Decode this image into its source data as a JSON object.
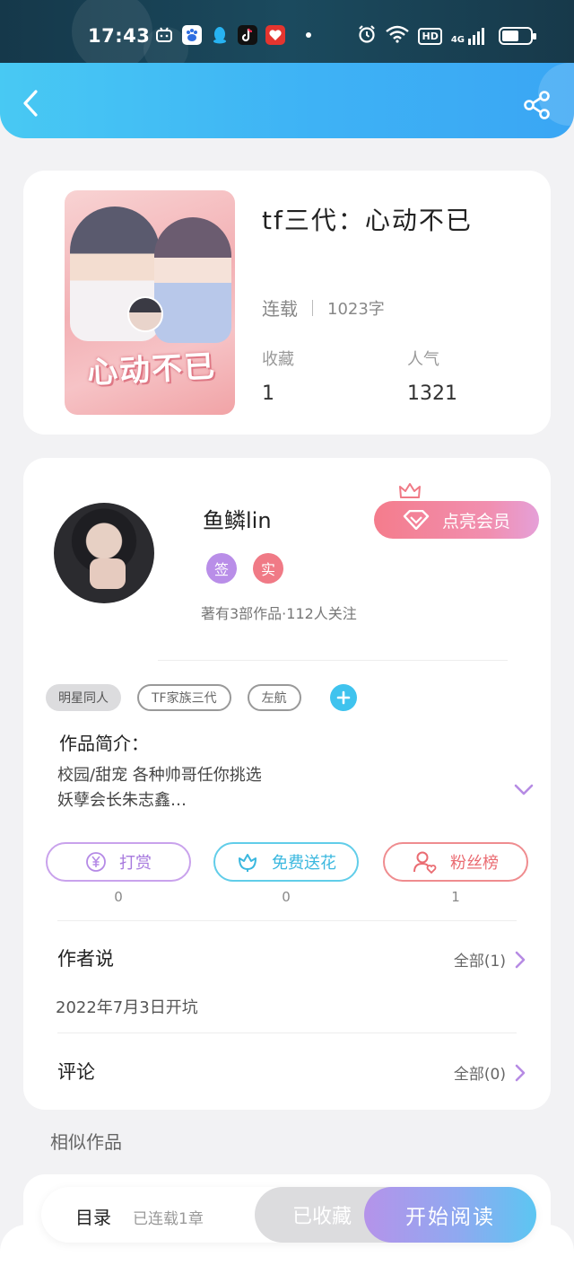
{
  "status_bar": {
    "time": "17:43",
    "apps": [
      "bilibili-icon",
      "baidu-icon",
      "qq-icon",
      "tiktok-icon",
      "heart-app-icon"
    ],
    "indicators": [
      "alarm-icon",
      "wifi-icon",
      "hd-icon",
      "signal-icon"
    ],
    "hd": "HD",
    "net": "4G",
    "battery_level": 0.6
  },
  "header": {
    "back_icon": "chevron-left-icon",
    "share_icon": "share-icon"
  },
  "book": {
    "title": "tf三代：心动不已",
    "cover_title": "心动不已",
    "status": "连载",
    "words": "1023字",
    "collect_label": "收藏",
    "collect_value": "1",
    "popularity_label": "人气",
    "popularity_value": "1321"
  },
  "author": {
    "name": "鱼鳞lin",
    "badge_sign": "签",
    "badge_real": "实",
    "info": "著有3部作品·112人关注",
    "vip_label": "点亮会员"
  },
  "tags": [
    "明星同人",
    "TF家族三代",
    "左航"
  ],
  "intro": {
    "title": "作品简介：",
    "text": "校园/甜宠 各种帅哥任你挑选\n妖孽会长朱志鑫…"
  },
  "actions": [
    {
      "label": "打赏",
      "count": "0",
      "icon": "yen-icon"
    },
    {
      "label": "免费送花",
      "count": "0",
      "icon": "flower-icon"
    },
    {
      "label": "粉丝榜",
      "count": "1",
      "icon": "fans-icon"
    }
  ],
  "author_says": {
    "title": "作者说",
    "link": "全部(1)",
    "content": "2022年7月3日开坑"
  },
  "comments": {
    "title": "评论",
    "link": "全部(0)"
  },
  "similar": {
    "title": "相似作品"
  },
  "bottom": {
    "toc": "目录",
    "toc_info": "已连载1章",
    "collected": "已收藏",
    "read": "开始阅读"
  },
  "colors": {
    "header_start": "#48c9f3",
    "header_end": "#3aa6f4",
    "vip": "#f47c8c",
    "tip": "#a779de",
    "flower": "#3bb8df",
    "fans": "#ea6c72"
  }
}
